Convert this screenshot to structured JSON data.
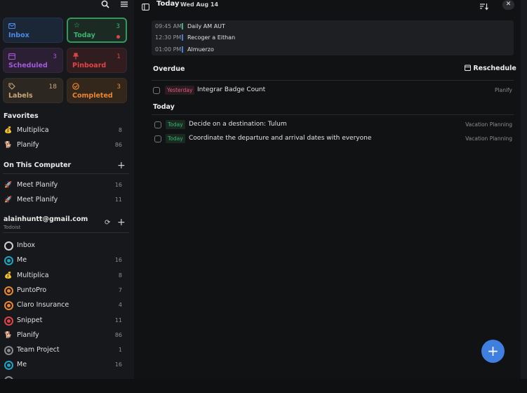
{
  "cards": [
    {
      "key": "inbox",
      "label": "Inbox",
      "count": "",
      "icon": "✉"
    },
    {
      "key": "today",
      "label": "Today",
      "count": "3",
      "icon": "☆"
    },
    {
      "key": "scheduled",
      "label": "Scheduled",
      "count": "3",
      "icon": "▦"
    },
    {
      "key": "pinboard",
      "label": "Pinboard",
      "count": "1",
      "icon": "📌"
    },
    {
      "key": "labels",
      "label": "Labels",
      "count": "18",
      "icon": "🏷"
    },
    {
      "key": "completed",
      "label": "Completed",
      "count": "3",
      "icon": "✓"
    }
  ],
  "favorites": {
    "title": "Favorites",
    "items": [
      {
        "icon": "💰",
        "name": "Multiplica",
        "count": "8"
      },
      {
        "icon": "🐕",
        "name": "Planify",
        "count": "86"
      }
    ]
  },
  "on_this_computer": {
    "title": "On This Computer",
    "items": [
      {
        "icon": "🚀",
        "name": "Meet Planify",
        "count": "16"
      },
      {
        "icon": "🚀",
        "name": "Meet Planify",
        "count": "11"
      }
    ]
  },
  "account": {
    "email": "alainhuntt@gmail.com",
    "provider": "Todoist",
    "items": [
      {
        "type": "ring",
        "color": "#d0d0d0",
        "name": "Inbox",
        "count": ""
      },
      {
        "type": "ring",
        "color": "#1fa3c2",
        "name": "Me",
        "count": "16"
      },
      {
        "type": "emoji",
        "icon": "💰",
        "name": "Multiplica",
        "count": "8"
      },
      {
        "type": "ring",
        "color": "#e8872e",
        "name": "PuntoPro",
        "count": "7"
      },
      {
        "type": "ring",
        "color": "#e8872e",
        "name": "Claro Insurance",
        "count": "4"
      },
      {
        "type": "ring",
        "color": "#e04545",
        "name": "Snippet",
        "count": "11"
      },
      {
        "type": "emoji",
        "icon": "🐕",
        "name": "Planify",
        "count": "86"
      },
      {
        "type": "ring",
        "color": "#8a8a8a",
        "name": "Team Project",
        "count": "1"
      },
      {
        "type": "ring",
        "color": "#1fa3c2",
        "name": "Me",
        "count": "16"
      }
    ]
  },
  "header": {
    "title": "Today",
    "date": "Wed Aug 14"
  },
  "events": [
    {
      "time": "09:45 AM",
      "name": "Daily AM AUT",
      "color": "#3bb273"
    },
    {
      "time": "12:30 PM",
      "name": "Recoger a Eithan",
      "color": "#3f7fe0"
    },
    {
      "time": "01:00 PM",
      "name": "Almuerzo",
      "color": "#3f7fe0"
    }
  ],
  "overdue": {
    "title": "Overdue",
    "reschedule_label": "Reschedule",
    "tasks": [
      {
        "badge": "Yesterday",
        "title": "Integrar Badge Count",
        "project": "Planify"
      }
    ]
  },
  "today": {
    "title": "Today",
    "tasks": [
      {
        "badge": "Today",
        "title": "Decide on a destination: Tulum",
        "project": "Vacation Planning"
      },
      {
        "badge": "Today",
        "title": "Coordinate the departure and arrival dates with everyone",
        "project": "Vacation Planning"
      }
    ]
  },
  "colors": {
    "accent": "#3f7fe0",
    "overdue_badge": "#e05a7a",
    "today_badge": "#3bb273"
  }
}
